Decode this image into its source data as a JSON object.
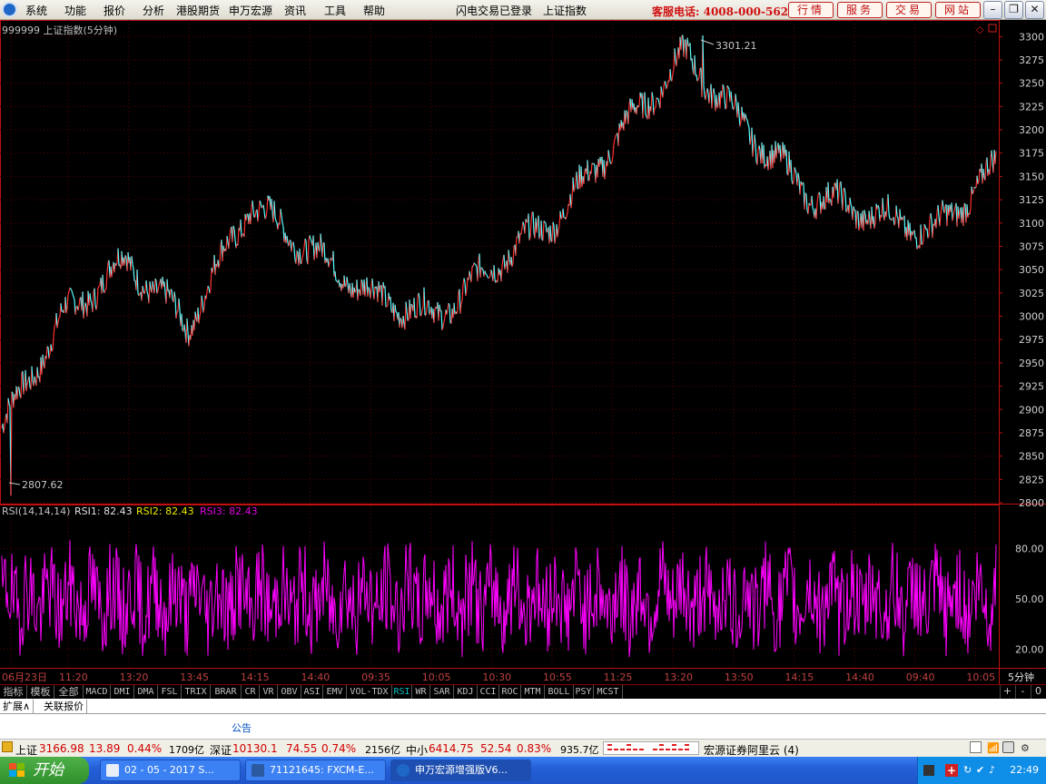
{
  "menubar": {
    "items": [
      "系统",
      "功能",
      "报价",
      "分析",
      "港股期货",
      "申万宏源",
      "资讯",
      "工具",
      "帮助"
    ],
    "login_status": "闪电交易已登录",
    "current_index": "上证指数",
    "hotline": "客服电话: 4008-000-562",
    "quick_buttons": [
      "行情",
      "服务",
      "交易",
      "网站"
    ]
  },
  "chart": {
    "title": "999999 上证指数(5分钟)",
    "price_axis_ticks": [
      "3300",
      "3275",
      "3250",
      "3225",
      "3200",
      "3175",
      "3150",
      "3125",
      "3100",
      "3075",
      "3050",
      "3025",
      "3000",
      "2975",
      "2950",
      "2925",
      "2900",
      "2875",
      "2850",
      "2825",
      "2800"
    ],
    "max_label": "3301.21",
    "min_label": "2807.62",
    "indicator_label": "RSI(14,14,14)",
    "rsi1_label": "RSI1: 82.43",
    "rsi2_label": "RSI2: 82.43",
    "rsi3_label": "RSI3: 82.43",
    "rsi_axis_ticks": [
      "80.00",
      "50.00",
      "20.00"
    ],
    "time_labels": [
      "06月23日",
      "11:20",
      "13:20",
      "13:45",
      "14:15",
      "14:40",
      "09:35",
      "10:05",
      "10:30",
      "10:55",
      "11:25",
      "13:20",
      "13:50",
      "14:15",
      "14:40",
      "09:40",
      "10:05"
    ],
    "period": "5分钟",
    "colors": {
      "price_up": "#54ffff",
      "price_down": "#ff3232",
      "rsi": "#ff00ff",
      "grid": "#5a0000",
      "axis": "#c01010"
    }
  },
  "chart_data": {
    "type": "line",
    "title": "999999 上证指数(5分钟)",
    "ylim": [
      2800,
      3310
    ],
    "x": [
      "06月23日",
      "11:20",
      "13:20",
      "13:45",
      "14:15",
      "14:40",
      "09:35",
      "10:05",
      "10:30",
      "10:55",
      "11:25",
      "13:20",
      "13:50",
      "14:15",
      "14:40",
      "09:40",
      "10:05"
    ],
    "series": [
      {
        "name": "上证指数",
        "values": [
          2880,
          3000,
          3060,
          2990,
          3120,
          3070,
          3020,
          3000,
          3060,
          3110,
          3200,
          3280,
          3200,
          3130,
          3110,
          3090,
          3160
        ]
      }
    ],
    "max": 3301.21,
    "min": 2807.62,
    "rsi": {
      "name": "RSI",
      "ylim": [
        10,
        95
      ],
      "latest": 82.43
    }
  },
  "tabs": [
    "指标",
    "模板",
    "全部",
    "MACD",
    "DMI",
    "DMA",
    "FSL",
    "TRIX",
    "BRAR",
    "CR",
    "VR",
    "OBV",
    "ASI",
    "EMV",
    "VOL-TDX",
    "RSI",
    "WR",
    "SAR",
    "KDJ",
    "CCI",
    "ROC",
    "MTM",
    "BOLL",
    "PSY",
    "MCST"
  ],
  "tab_controls": [
    "+",
    "-",
    "0"
  ],
  "subtabs": [
    "扩展∧",
    "关联报价"
  ],
  "notice": "公告",
  "status": {
    "sh_label": "上证",
    "sh_value": "3166.98",
    "sh_change": "13.89",
    "sh_pct": "0.44%",
    "sh_amount": "1709亿",
    "sz_label": "深证",
    "sz_value": "10130.1",
    "sz_change": "74.55",
    "sz_pct": "0.74%",
    "sz_amount": "2156亿",
    "zx_label": "中小",
    "zx_value": "6414.75",
    "zx_change": "52.54",
    "zx_pct": "0.83%",
    "zx_amount": "935.7亿",
    "server": "宏源证券阿里云 (4)"
  },
  "taskbar": {
    "start": "开始",
    "tasks": [
      "02 - 05 - 2017 S...",
      "71121645: FXCM-E...",
      "申万宏源增强版V6..."
    ],
    "clock": "22:49"
  }
}
